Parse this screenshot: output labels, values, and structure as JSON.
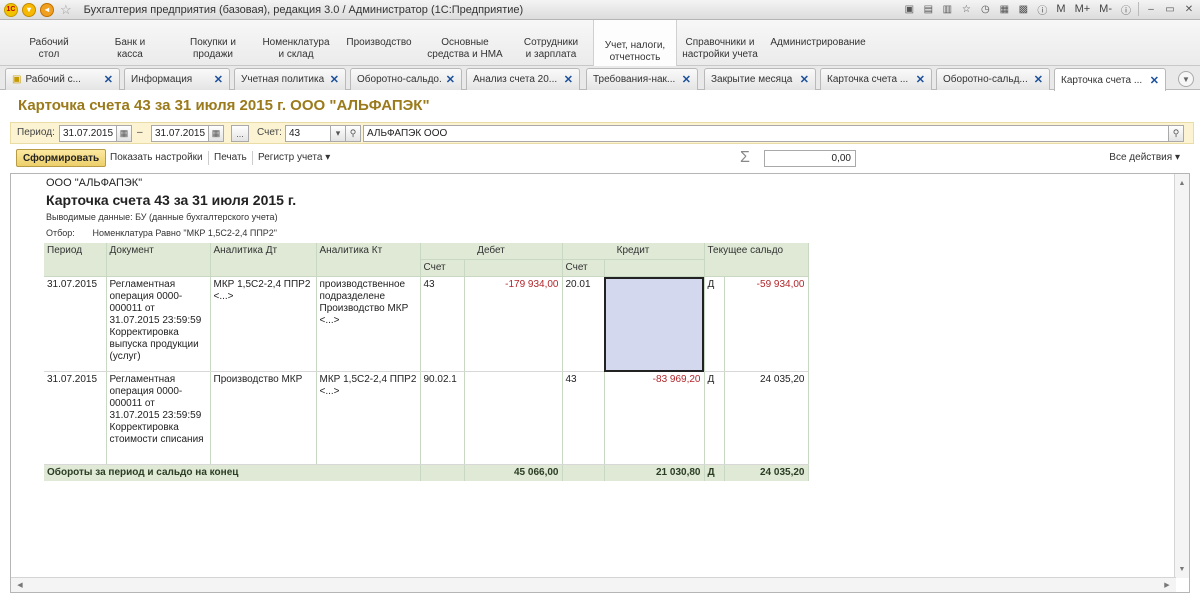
{
  "window": {
    "title": "Бухгалтерия предприятия (базовая), редакция 3.0 / Администратор  (1С:Предприятие)",
    "logo_text": "1С",
    "right_buttons": [
      "M",
      "M+",
      "M-"
    ]
  },
  "sections": [
    {
      "label": "Рабочий стол",
      "line1": "Рабочий",
      "line2": "стол"
    },
    {
      "label": "Банк и касса",
      "line1": "Банк и",
      "line2": "касса"
    },
    {
      "label": "Покупки и продажи",
      "line1": "Покупки и",
      "line2": "продажи"
    },
    {
      "label": "Номенклатура и склад",
      "line1": "Номенклатура",
      "line2": "и склад"
    },
    {
      "label": "Производство",
      "line1": "Производство",
      "line2": ""
    },
    {
      "label": "Основные средства и НМА",
      "line1": "Основные",
      "line2": "средства и НМА"
    },
    {
      "label": "Сотрудники и зарплата",
      "line1": "Сотрудники",
      "line2": "и зарплата"
    },
    {
      "label": "Учет, налоги, отчетность",
      "line1": "Учет, налоги,",
      "line2": "отчетность",
      "line0": ""
    },
    {
      "label": "Справочники и настройки учета",
      "line1": "Справочники и",
      "line2": "настройки учета"
    },
    {
      "label": "Администрирование",
      "line1": "Администрирование",
      "line2": ""
    }
  ],
  "tabs": [
    {
      "label": "Рабочий с..."
    },
    {
      "label": "Информация"
    },
    {
      "label": "Учетная политика"
    },
    {
      "label": "Оборотно-сальдо..."
    },
    {
      "label": "Анализ счета 20..."
    },
    {
      "label": "Требования-нак..."
    },
    {
      "label": "Закрытие месяца"
    },
    {
      "label": "Карточка счета ..."
    },
    {
      "label": "Оборотно-сальд..."
    },
    {
      "label": "Карточка счета ..."
    }
  ],
  "form": {
    "title": "Карточка счета 43 за 31 июля 2015 г. ООО \"АЛЬФАПЭК\"",
    "period_label": "Период:",
    "period_from": "31.07.2015",
    "period_dash": "–",
    "period_to": "31.07.2015",
    "dots": "...",
    "account_label": "Счет:",
    "account": "43",
    "organization": "АЛЬФАПЭК ООО"
  },
  "commands": {
    "generate": "Сформировать",
    "show_settings": "Показать настройки",
    "print": "Печать",
    "register": "Регистр учета",
    "sum_value": "0,00",
    "all_actions": "Все действия"
  },
  "report": {
    "org": "ООО \"АЛЬФАПЭК\"",
    "title": "Карточка счета 43 за 31 июля 2015 г.",
    "output_label": "Выводимые данные:",
    "output_value": "БУ (данные бухгалтерского учета)",
    "filter_label": "Отбор:",
    "filter_value": "Номенклатура Равно \"МКР 1,5С2-2,4 ППР2\"",
    "headers": {
      "period": "Период",
      "document": "Документ",
      "analytics_dt": "Аналитика Дт",
      "analytics_kt": "Аналитика Кт",
      "debit": "Дебет",
      "credit": "Кредит",
      "balance": "Текущее сальдо",
      "account": "Счет"
    },
    "rows": [
      {
        "period": "31.07.2015",
        "document": "Регламентная операция 0000-000011 от 31.07.2015 23:59:59 Корректировка выпуска продукции (услуг)",
        "analytics_dt": "МКР 1,5С2-2,4 ППР2 <...>",
        "analytics_kt": "производственное подразделене Производство МКР <...>",
        "debit_account": "43",
        "debit_amount": "-179 934,00",
        "credit_account": "20.01",
        "credit_amount": "",
        "balance_side": "Д",
        "balance": "-59 934,00"
      },
      {
        "period": "31.07.2015",
        "document": "Регламентная операция 0000-000011 от 31.07.2015 23:59:59 Корректировка стоимости списания",
        "analytics_dt": "Производство МКР",
        "analytics_kt": "МКР 1,5С2-2,4 ППР2 <...>",
        "debit_account": "90.02.1",
        "debit_amount": "",
        "credit_account": "43",
        "credit_amount": "-83 969,20",
        "balance_side": "Д",
        "balance": "24 035,20"
      }
    ],
    "total": {
      "label": "Обороты за период и сальдо на конец",
      "debit": "45 066,00",
      "credit": "21 030,80",
      "side": "Д",
      "balance": "24 035,20"
    }
  }
}
